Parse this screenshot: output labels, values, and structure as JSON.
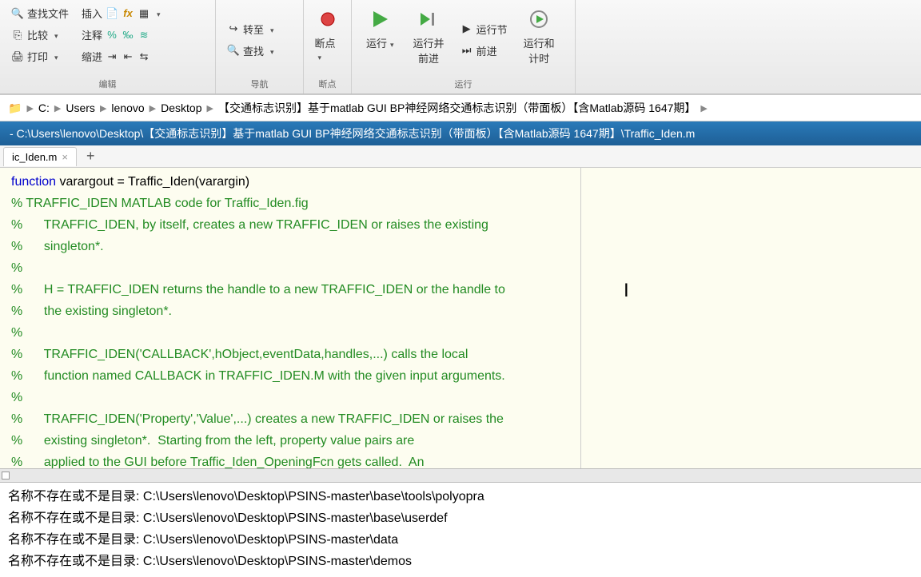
{
  "ribbon": {
    "group1": {
      "findFiles": "查找文件",
      "compare": "比较",
      "print": "打印",
      "insert": "插入"
    },
    "group2": {
      "comment": "注释",
      "indent": "缩进",
      "label": "编辑"
    },
    "group3": {
      "goto": "转至",
      "find": "查找",
      "label": "导航"
    },
    "group4": {
      "breakpoint": "断点",
      "label": "断点"
    },
    "group5": {
      "run": "运行",
      "runAdvance": "运行并\n前进",
      "runSection": "运行节",
      "advance": "前进",
      "runTime": "运行和\n计时",
      "label": "运行"
    }
  },
  "breadcrumb": {
    "drive": "C:",
    "p1": "Users",
    "p2": "lenovo",
    "p3": "Desktop",
    "p4": "【交通标志识别】基于matlab GUI BP神经网络交通标志识别（带面板）【含Matlab源码 1647期】"
  },
  "titlebar": "- C:\\Users\\lenovo\\Desktop\\【交通标志识别】基于matlab GUI BP神经网络交通标志识别（带面板）【含Matlab源码 1647期】\\Traffic_Iden.m",
  "tab": {
    "name": "ic_Iden.m"
  },
  "code": {
    "l1a": "function",
    "l1b": " varargout = Traffic_Iden(varargin)",
    "l2": "% TRAFFIC_IDEN MATLAB code for Traffic_Iden.fig",
    "l3": "%      TRAFFIC_IDEN, by itself, creates a new TRAFFIC_IDEN or raises the existing",
    "l4": "%      singleton*.",
    "l5": "%",
    "l6": "%      H = TRAFFIC_IDEN returns the handle to a new TRAFFIC_IDEN or the handle to",
    "l7": "%      the existing singleton*.",
    "l8": "%",
    "l9": "%      TRAFFIC_IDEN('CALLBACK',hObject,eventData,handles,...) calls the local",
    "l10": "%      function named CALLBACK in TRAFFIC_IDEN.M with the given input arguments.",
    "l11": "%",
    "l12": "%      TRAFFIC_IDEN('Property','Value',...) creates a new TRAFFIC_IDEN or raises the",
    "l13": "%      existing singleton*.  Starting from the left, property value pairs are",
    "l14": "%      applied to the GUI before Traffic_Iden_OpeningFcn gets called.  An"
  },
  "console": {
    "prefix": "名称不存在或不是目录: ",
    "l1": "C:\\Users\\lenovo\\Desktop\\PSINS-master\\base\\tools\\polyopra",
    "l2": "C:\\Users\\lenovo\\Desktop\\PSINS-master\\base\\userdef",
    "l3": "C:\\Users\\lenovo\\Desktop\\PSINS-master\\data",
    "l4": "C:\\Users\\lenovo\\Desktop\\PSINS-master\\demos"
  }
}
